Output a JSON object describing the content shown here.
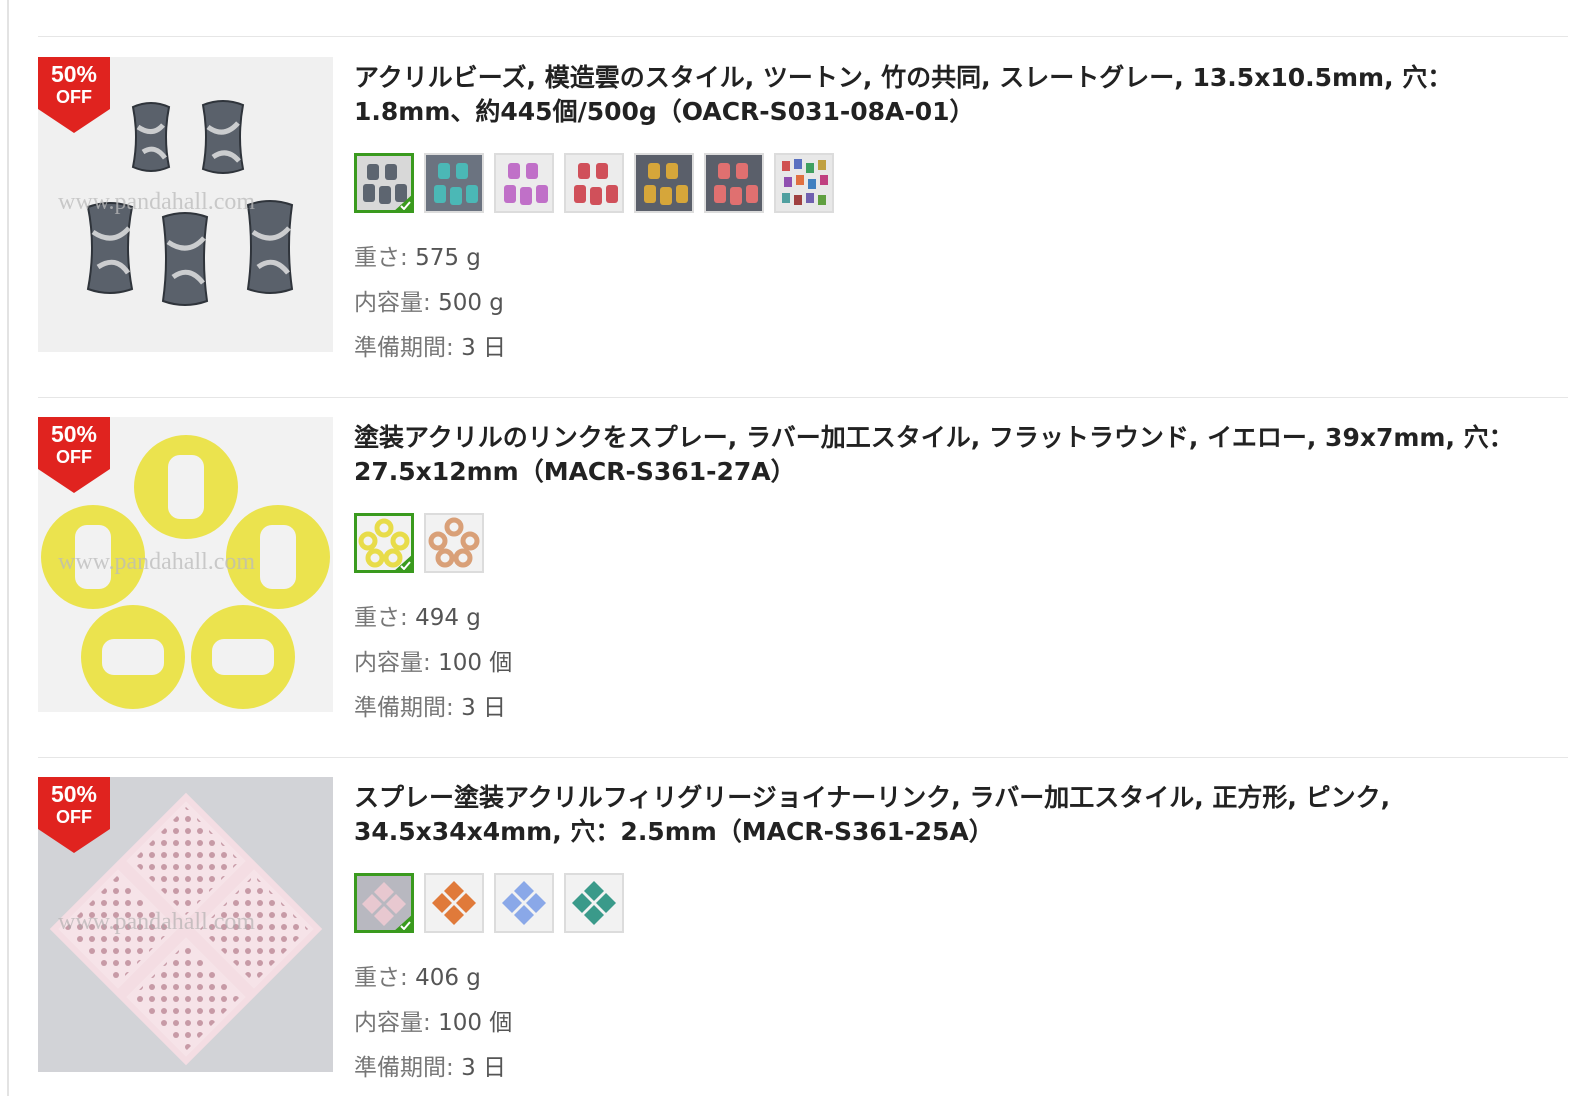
{
  "badge": {
    "percent": "50%",
    "off": "OFF"
  },
  "labels": {
    "weight": "重さ: ",
    "capacity": "内容量: ",
    "lead_time": "準備期間: "
  },
  "products": [
    {
      "title": "アクリルビーズ, 模造雲のスタイル, ツートン, 竹の共同, スレートグレー, 13.5x10.5mm, 穴：1.8mm、約445個/500g（OACR-S031-08A-01）",
      "weight": "575 g",
      "capacity": "500 g",
      "lead_time": "3 日",
      "swatch_colors": [
        "#5d6570",
        "#4bb8b6",
        "#c070c8",
        "#d0505a",
        "#d6a63a",
        "#e07070",
        "#7a6aa0"
      ]
    },
    {
      "title": "塗装アクリルのリンクをスプレー, ラバー加工スタイル, フラットラウンド, イエロー, 39x7mm, 穴：27.5x12mm（MACR-S361-27A）",
      "weight": "494 g",
      "capacity": "100 個",
      "lead_time": "3 日",
      "swatch_colors": [
        "#e8dc4a",
        "#d9a078"
      ]
    },
    {
      "title": "スプレー塗装アクリルフィリグリージョイナーリンク, ラバー加工スタイル, 正方形, ピンク, 34.5x34x4mm, 穴：2.5mm（MACR-S361-25A）",
      "weight": "406 g",
      "capacity": "100 個",
      "lead_time": "3 日",
      "swatch_colors": [
        "#e8c8d0",
        "#e07a3a",
        "#8aa8e8",
        "#3a9a8a"
      ]
    }
  ],
  "colors": {
    "badge_red": "#e0231f",
    "selected_border": "#3a9a1e"
  }
}
